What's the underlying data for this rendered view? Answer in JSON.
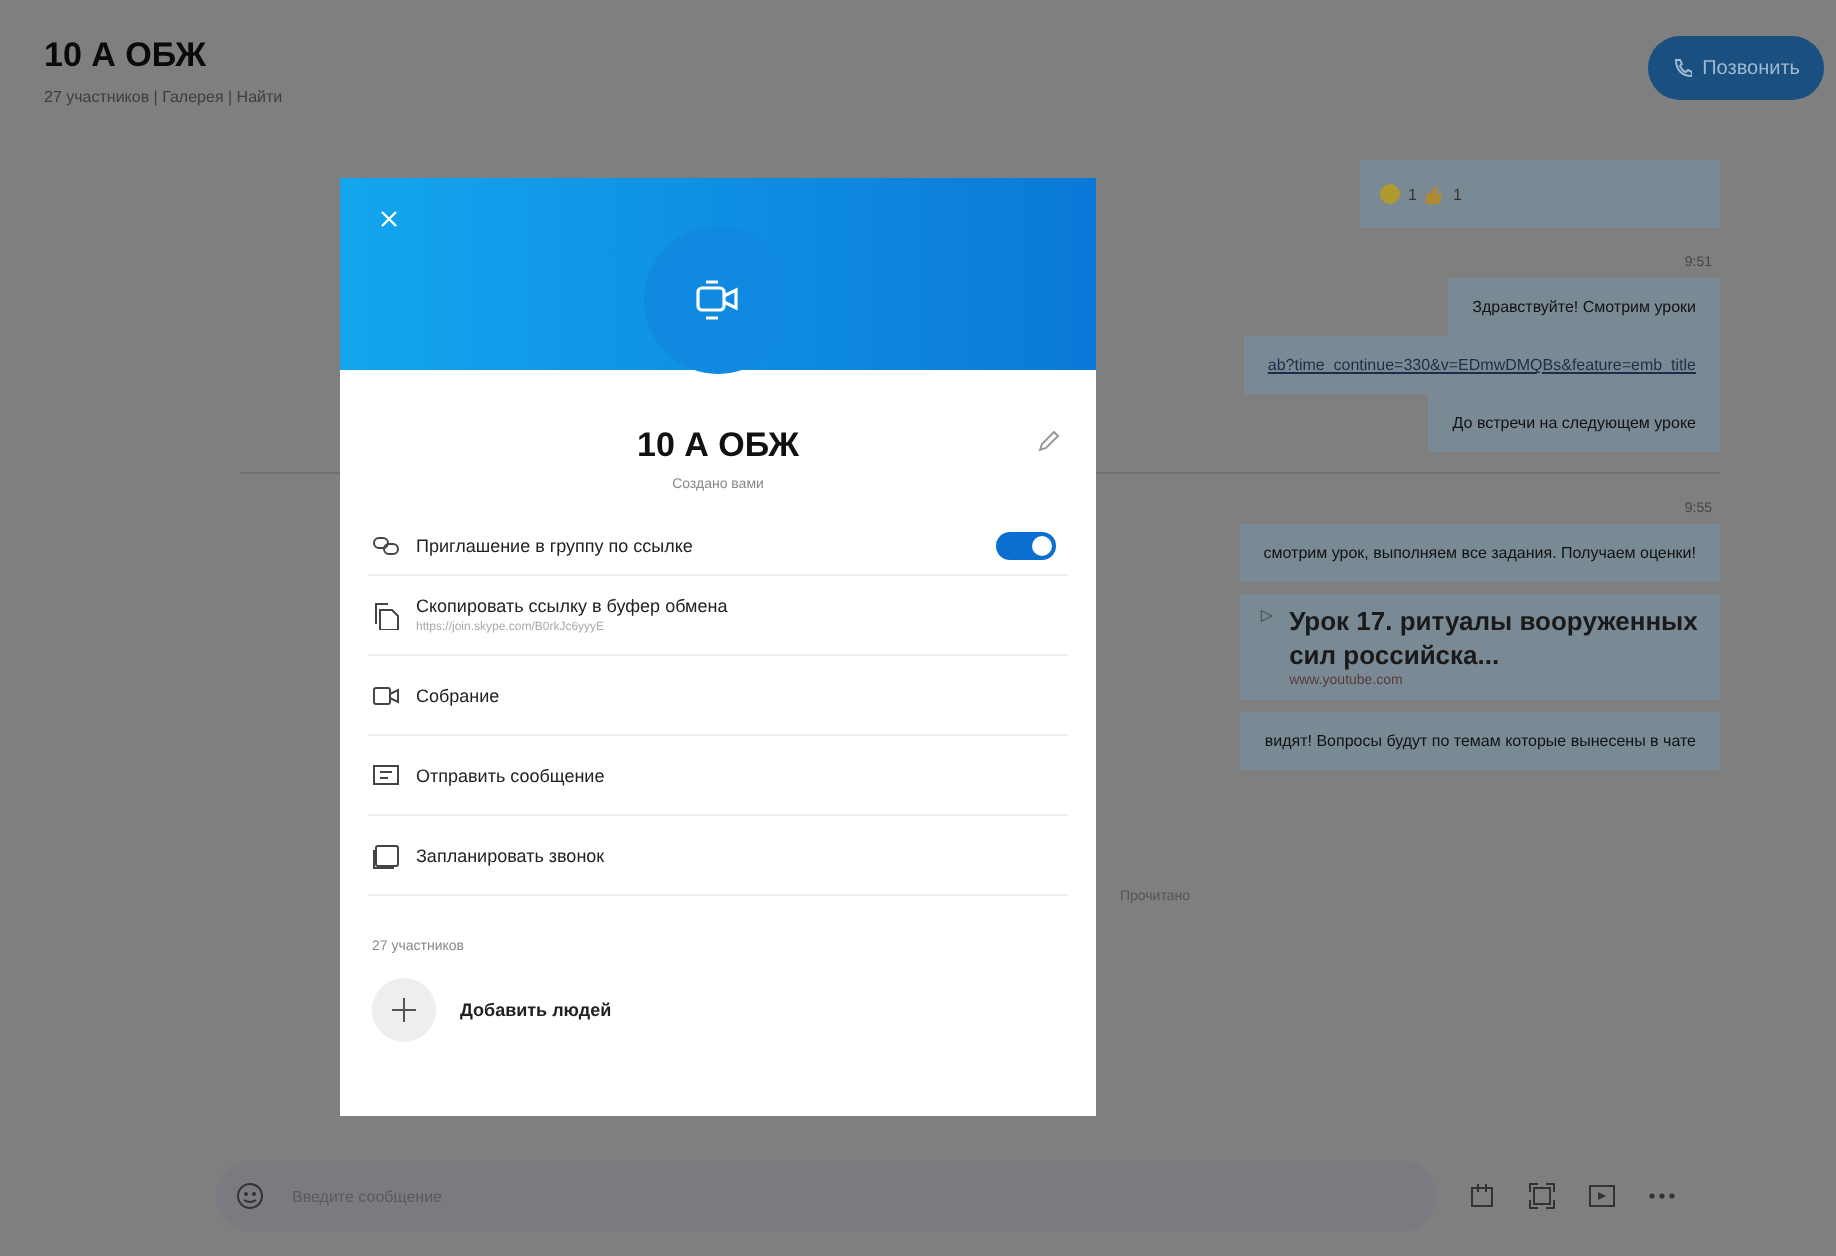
{
  "header": {
    "title": "10 А ОБЖ",
    "subtitle": "27 участников | Галерея | Найти",
    "call_button": "Позвонить"
  },
  "chat": [
    {
      "kind": "reactions",
      "counts": [
        "1",
        "1"
      ]
    },
    {
      "kind": "time",
      "text": "9:51"
    },
    {
      "kind": "text",
      "text": "Здравствуйте! Смотрим уроки"
    },
    {
      "kind": "link",
      "text": "ab?time_continue=330&v=EDmwDMQBs&feature=emb_title"
    },
    {
      "kind": "text",
      "text": "До встречи на следующем уроке"
    },
    {
      "kind": "divider"
    },
    {
      "kind": "time",
      "text": "9:55"
    },
    {
      "kind": "text",
      "text": "смотрим урок, выполняем все задания. Получаем оценки!"
    },
    {
      "kind": "card",
      "title": "Урок 17. ритуалы вооруженных сил российска...",
      "source": "www.youtube.com"
    },
    {
      "kind": "text",
      "text": "видят! Вопросы будут по темам которые вынесены в чате"
    },
    {
      "kind": "status",
      "text": "Прочитано"
    }
  ],
  "composer": {
    "placeholder": "Введите сообщение"
  },
  "modal": {
    "title": "10 А ОБЖ",
    "subtitle": "Создано вами",
    "menu": [
      {
        "kind": "toggle",
        "label": "Приглашение в группу по ссылке",
        "on": true
      },
      {
        "kind": "copy",
        "label": "Скопировать ссылку в буфер обмена",
        "url": "https://join.skype.com/B0rkJc6yyyE"
      },
      {
        "kind": "meeting",
        "label": "Собрание"
      },
      {
        "kind": "message",
        "label": "Отправить сообщение"
      },
      {
        "kind": "schedule",
        "label": "Запланировать звонок"
      }
    ],
    "participants_label": "27 участников",
    "add_people": "Добавить людей"
  }
}
